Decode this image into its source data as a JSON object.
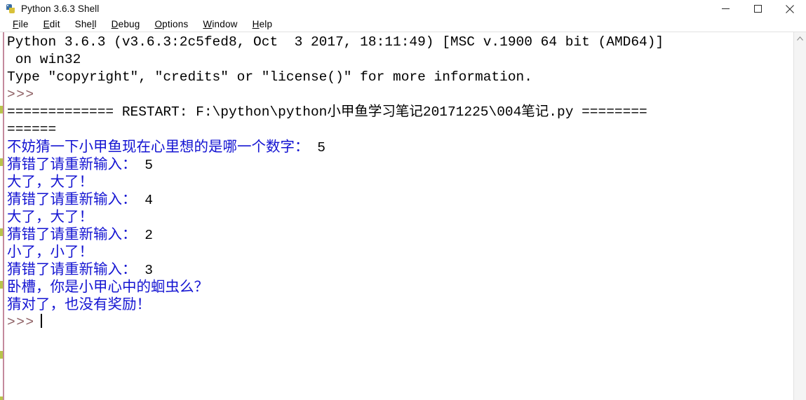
{
  "window": {
    "title": "Python 3.6.3 Shell",
    "icon": "python-idle-icon",
    "controls": {
      "minimize": "minimize-icon",
      "maximize": "maximize-icon",
      "close": "close-icon"
    }
  },
  "menubar": {
    "items": [
      {
        "label": "File",
        "mnemonic_index": 0
      },
      {
        "label": "Edit",
        "mnemonic_index": 0
      },
      {
        "label": "Shell",
        "mnemonic_index": 4
      },
      {
        "label": "Debug",
        "mnemonic_index": 0
      },
      {
        "label": "Options",
        "mnemonic_index": 0
      },
      {
        "label": "Window",
        "mnemonic_index": 0
      },
      {
        "label": "Help",
        "mnemonic_index": 0
      }
    ]
  },
  "colors": {
    "stdout_blue": "#1414d2",
    "prompt_mauve": "#8d5f63",
    "text_black": "#000000",
    "gutter_pink": "#c48a9d",
    "gutter_mark": "#b8c44a"
  },
  "shell": {
    "lines": [
      {
        "kind": "banner",
        "text": "Python 3.6.3 (v3.6.3:2c5fed8, Oct  3 2017, 18:11:49) [MSC v.1900 64 bit (AMD64)]",
        "color": "black"
      },
      {
        "kind": "banner",
        "text": " on win32",
        "color": "black"
      },
      {
        "kind": "banner",
        "text": "Type ″copyright″, ″credits″ or ″license()″ for more information.",
        "color": "black"
      },
      {
        "kind": "prompt",
        "text": ">>>",
        "color": "prompt"
      },
      {
        "kind": "restart",
        "text": "============= RESTART: F:\\python\\python小甲鱼学习笔记20171225\\004笔记.py ========",
        "color": "black"
      },
      {
        "kind": "restart",
        "text": "======",
        "color": "black"
      },
      {
        "kind": "io",
        "cjk": true,
        "blue_text": "不妨猜一下小甲鱼现在心里想的是哪一个数字：",
        "input_text": "5"
      },
      {
        "kind": "io",
        "cjk": true,
        "blue_text": "猜错了请重新输入：",
        "input_text": "5"
      },
      {
        "kind": "io",
        "cjk": true,
        "blue_text": "大了，大了！",
        "input_text": ""
      },
      {
        "kind": "io",
        "cjk": true,
        "blue_text": "猜错了请重新输入：",
        "input_text": "4"
      },
      {
        "kind": "io",
        "cjk": true,
        "blue_text": "大了，大了！",
        "input_text": ""
      },
      {
        "kind": "io",
        "cjk": true,
        "blue_text": "猜错了请重新输入：",
        "input_text": "2"
      },
      {
        "kind": "io",
        "cjk": true,
        "blue_text": "小了，小了！",
        "input_text": ""
      },
      {
        "kind": "io",
        "cjk": true,
        "blue_text": "猜错了请重新输入：",
        "input_text": "3"
      },
      {
        "kind": "io",
        "cjk": true,
        "blue_text": "卧槽，你是小甲心中的蛔虫么？",
        "input_text": ""
      },
      {
        "kind": "io",
        "cjk": true,
        "blue_text": "猜对了，也没有奖励！",
        "input_text": ""
      },
      {
        "kind": "prompt_caret",
        "text": ">>>",
        "color": "prompt"
      }
    ]
  },
  "scrollbar": {
    "up_arrow": "chevron-up-icon"
  }
}
